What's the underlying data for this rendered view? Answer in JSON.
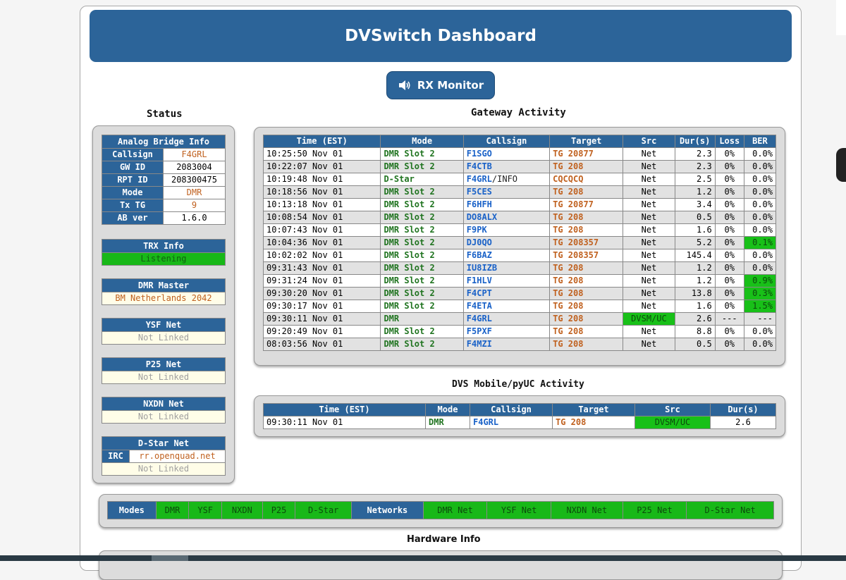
{
  "header": {
    "title": "DVSwitch Dashboard"
  },
  "rx_button": {
    "label": "RX Monitor"
  },
  "status": {
    "title": "Status",
    "analog_bridge": {
      "title": "Analog Bridge Info",
      "rows": [
        {
          "label": "Callsign",
          "value": "F4GRL"
        },
        {
          "label": "GW ID",
          "value": "2083004"
        },
        {
          "label": "RPT ID",
          "value": "208300475"
        },
        {
          "label": "Mode",
          "value": "DMR"
        },
        {
          "label": "Tx TG",
          "value": "9"
        },
        {
          "label": "AB ver",
          "value": "1.6.0"
        }
      ]
    },
    "trx": {
      "title": "TRX Info",
      "value": "Listening"
    },
    "dmr_master": {
      "title": "DMR Master",
      "value": "BM Netherlands 2042"
    },
    "ysf": {
      "title": "YSF Net",
      "value": "Not Linked"
    },
    "p25": {
      "title": "P25 Net",
      "value": "Not Linked"
    },
    "nxdn": {
      "title": "NXDN Net",
      "value": "Not Linked"
    },
    "dstar": {
      "title": "D-Star Net",
      "irc_label": "IRC",
      "irc_value": "rr.openquad.net",
      "value": "Not Linked"
    }
  },
  "gateway": {
    "title": "Gateway Activity",
    "headers": [
      "Time (EST)",
      "Mode",
      "Callsign",
      "Target",
      "Src",
      "Dur(s)",
      "Loss",
      "BER"
    ],
    "rows": [
      {
        "time": "10:25:50 Nov 01",
        "mode": "DMR Slot 2",
        "call": "F1SGO",
        "call_suffix": "",
        "target": "TG 20877",
        "src": "Net",
        "dur": "2.3",
        "loss": "0%",
        "ber": "0.0%",
        "ber_hi": false
      },
      {
        "time": "10:22:07 Nov 01",
        "mode": "DMR Slot 2",
        "call": "F4CTB",
        "call_suffix": "",
        "target": "TG 208",
        "src": "Net",
        "dur": "2.3",
        "loss": "0%",
        "ber": "0.0%",
        "ber_hi": false
      },
      {
        "time": "10:19:48 Nov 01",
        "mode": "D-Star",
        "call": "F4GRL",
        "call_suffix": "/INFO",
        "target": "CQCQCQ",
        "src": "Net",
        "dur": "2.5",
        "loss": "0%",
        "ber": "0.0%",
        "ber_hi": false
      },
      {
        "time": "10:18:56 Nov 01",
        "mode": "DMR Slot 2",
        "call": "F5CES",
        "call_suffix": "",
        "target": "TG 208",
        "src": "Net",
        "dur": "1.2",
        "loss": "0%",
        "ber": "0.0%",
        "ber_hi": false
      },
      {
        "time": "10:13:18 Nov 01",
        "mode": "DMR Slot 2",
        "call": "F6HFH",
        "call_suffix": "",
        "target": "TG 20877",
        "src": "Net",
        "dur": "3.4",
        "loss": "0%",
        "ber": "0.0%",
        "ber_hi": false
      },
      {
        "time": "10:08:54 Nov 01",
        "mode": "DMR Slot 2",
        "call": "DO8ALX",
        "call_suffix": "",
        "target": "TG 208",
        "src": "Net",
        "dur": "0.5",
        "loss": "0%",
        "ber": "0.0%",
        "ber_hi": false
      },
      {
        "time": "10:07:43 Nov 01",
        "mode": "DMR Slot 2",
        "call": "F9PK",
        "call_suffix": "",
        "target": "TG 208",
        "src": "Net",
        "dur": "1.6",
        "loss": "0%",
        "ber": "0.0%",
        "ber_hi": false
      },
      {
        "time": "10:04:36 Nov 01",
        "mode": "DMR Slot 2",
        "call": "DJ0QO",
        "call_suffix": "",
        "target": "TG 208357",
        "src": "Net",
        "dur": "5.2",
        "loss": "0%",
        "ber": "0.1%",
        "ber_hi": true
      },
      {
        "time": "10:02:02 Nov 01",
        "mode": "DMR Slot 2",
        "call": "F6BAZ",
        "call_suffix": "",
        "target": "TG 208357",
        "src": "Net",
        "dur": "145.4",
        "loss": "0%",
        "ber": "0.0%",
        "ber_hi": false
      },
      {
        "time": "09:31:43 Nov 01",
        "mode": "DMR Slot 2",
        "call": "IU8IZB",
        "call_suffix": "",
        "target": "TG 208",
        "src": "Net",
        "dur": "1.2",
        "loss": "0%",
        "ber": "0.0%",
        "ber_hi": false
      },
      {
        "time": "09:31:24 Nov 01",
        "mode": "DMR Slot 2",
        "call": "F1HLV",
        "call_suffix": "",
        "target": "TG 208",
        "src": "Net",
        "dur": "1.2",
        "loss": "0%",
        "ber": "0.9%",
        "ber_hi": true
      },
      {
        "time": "09:30:20 Nov 01",
        "mode": "DMR Slot 2",
        "call": "F4CPT",
        "call_suffix": "",
        "target": "TG 208",
        "src": "Net",
        "dur": "13.8",
        "loss": "0%",
        "ber": "0.3%",
        "ber_hi": true
      },
      {
        "time": "09:30:17 Nov 01",
        "mode": "DMR Slot 2",
        "call": "F4ETA",
        "call_suffix": "",
        "target": "TG 208",
        "src": "Net",
        "dur": "1.6",
        "loss": "0%",
        "ber": "1.5%",
        "ber_hi": true
      },
      {
        "time": "09:30:11 Nov 01",
        "mode": "DMR",
        "call": "F4GRL",
        "call_suffix": "",
        "target": "TG 208",
        "src": "DVSM/UC",
        "src_hi": true,
        "dur": "2.6",
        "loss": "---",
        "ber": "---",
        "ber_hi": false
      },
      {
        "time": "09:20:49 Nov 01",
        "mode": "DMR Slot 2",
        "call": "F5PXF",
        "call_suffix": "",
        "target": "TG 208",
        "src": "Net",
        "dur": "8.8",
        "loss": "0%",
        "ber": "0.0%",
        "ber_hi": false
      },
      {
        "time": "08:03:56 Nov 01",
        "mode": "DMR Slot 2",
        "call": "F4MZI",
        "call_suffix": "",
        "target": "TG 208",
        "src": "Net",
        "dur": "0.5",
        "loss": "0%",
        "ber": "0.0%",
        "ber_hi": false
      }
    ]
  },
  "dvs": {
    "title": "DVS Mobile/pyUC Activity",
    "headers": [
      "Time (EST)",
      "Mode",
      "Callsign",
      "Target",
      "Src",
      "Dur(s)"
    ],
    "rows": [
      {
        "time": "09:30:11 Nov 01",
        "mode": "DMR",
        "call": "F4GRL",
        "target": "TG 208",
        "src": "DVSM/UC",
        "dur": "2.6"
      }
    ]
  },
  "modes_bar": {
    "modes_label": "Modes",
    "modes": [
      "DMR",
      "YSF",
      "NXDN",
      "P25",
      "D-Star"
    ],
    "networks_label": "Networks",
    "networks": [
      "DMR Net",
      "YSF Net",
      "NXDN Net",
      "P25 Net",
      "D-Star Net"
    ]
  },
  "hardware": {
    "title": "Hardware Info"
  },
  "colors": {
    "primary": "#2c6499",
    "active_green": "#18b818",
    "target_orange": "#c0611f",
    "callsign_blue": "#1a62c8"
  }
}
